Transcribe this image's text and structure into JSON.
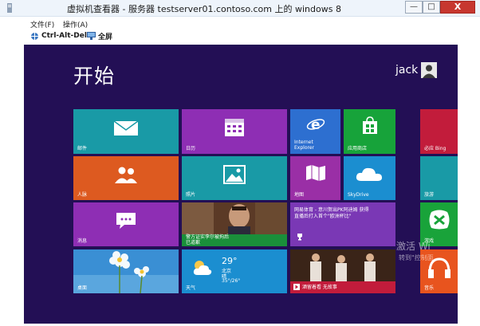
{
  "window": {
    "title": "虚拟机查看器 - 服务器 testserver01.contoso.com 上的 windows 8",
    "min_glyph": "—",
    "max_glyph": "□",
    "close_glyph": "X"
  },
  "menu": {
    "file": "文件(F)",
    "action": "操作(A)"
  },
  "toolbar": {
    "cad": "Ctrl-Alt-Del",
    "fullscreen": "全屏"
  },
  "start": {
    "title": "开始",
    "user": "jack"
  },
  "tiles": {
    "mail": "邮件",
    "calendar": "日历",
    "ie_line1": "Internet",
    "ie_line2": "Explorer",
    "store": "应用商店",
    "bing": "必应 Bing",
    "people": "人脉",
    "photos": "照片",
    "travel": "旅游",
    "maps": "地图",
    "skydrive": "SkyDrive",
    "messaging": "消息",
    "news_caption_1": "警方证实李尔被拘后",
    "news_caption_2": "已道歉",
    "sports_line1": "网易体育 - 意川贺出PK阿迪姆 获得",
    "sports_line2": "直播后打入首个\"欧洲杯比\"",
    "games": "游戏",
    "desktop": "桌面",
    "weather_temp": "29°",
    "weather_city": "北京",
    "weather_desc": "晴",
    "weather_range": "35°/26°",
    "weather_label": "天气",
    "music_caption": "酒留着看 无故事",
    "music": "音乐"
  },
  "watermark": {
    "line1": "激活 Wi",
    "line2": "转到\"控制面"
  },
  "colors": {
    "start_bg": "#230f55",
    "teal": "#199aa6",
    "orange": "#dd5a20",
    "purple": "#8e2eb4",
    "magenta": "#9a2fa6",
    "blue_ie": "#2d6fd0",
    "store_green": "#17a33a",
    "red": "#c21c3b",
    "sky_blue": "#1b8ed0",
    "games_green": "#19a33a",
    "orange_music": "#e8541e",
    "violet": "#7a38b5"
  }
}
